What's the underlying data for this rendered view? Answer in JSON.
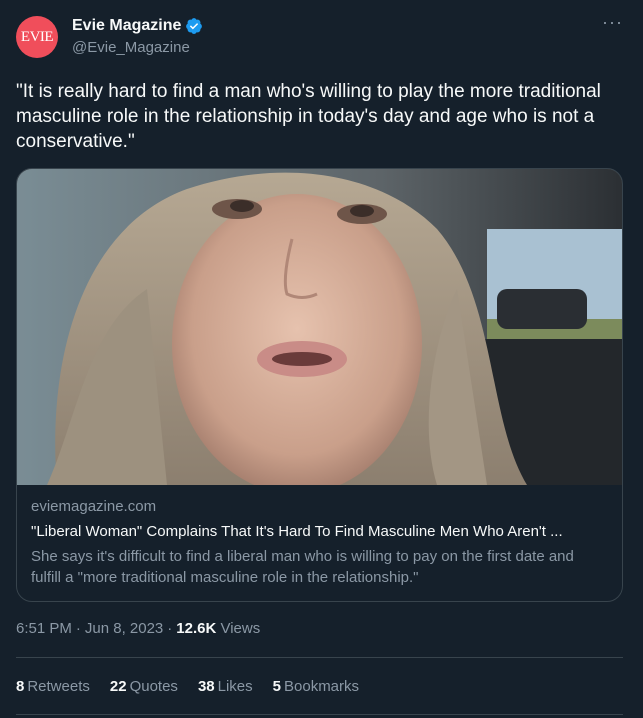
{
  "author": {
    "display_name": "Evie Magazine",
    "handle": "@Evie_Magazine",
    "avatar_text": "EVIE",
    "avatar_color": "#f04e5b",
    "verified_color": "#1d9bf0"
  },
  "more_icon": "more-horizontal-icon",
  "tweet_text": "\"It is really hard to find a man who's willing to play the more traditional masculine role in the relationship in today's day and age who is not a conservative.\"",
  "card": {
    "domain": "eviemagazine.com",
    "title": "\"Liberal Woman\" Complains That It's Hard To Find Masculine Men Who Aren't ...",
    "description": "She says it's difficult to find a liberal man who is willing to pay on the first date and fulfill a \"more traditional masculine role in the relationship.\""
  },
  "meta": {
    "time": "6:51 PM",
    "date": "Jun 8, 2023",
    "views_count": "12.6K",
    "views_label": "Views"
  },
  "stats": {
    "retweets_count": "8",
    "retweets_label": "Retweets",
    "quotes_count": "22",
    "quotes_label": "Quotes",
    "likes_count": "38",
    "likes_label": "Likes",
    "bookmarks_count": "5",
    "bookmarks_label": "Bookmarks"
  },
  "colors": {
    "background": "#15202b",
    "text": "#f7f9f9",
    "muted": "#8b98a5",
    "border": "#38444d"
  }
}
